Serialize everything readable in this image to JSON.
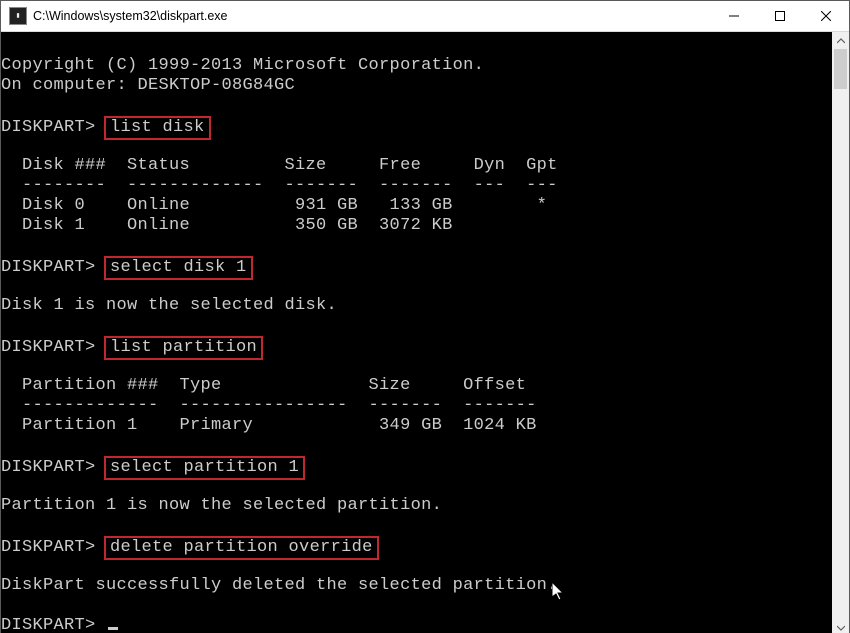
{
  "window": {
    "title": "C:\\Windows\\system32\\diskpart.exe",
    "icon_glyph": "C:\\"
  },
  "copyright": "Copyright (C) 1999-2013 Microsoft Corporation.",
  "computer_line": "On computer: DESKTOP-08G84GC",
  "prompt": "DISKPART>",
  "commands": {
    "c1": "list disk",
    "c2": "select disk 1",
    "c3": "list partition",
    "c4": "select partition 1",
    "c5": "delete partition override"
  },
  "disk_header": "  Disk ###  Status         Size     Free     Dyn  Gpt",
  "disk_divider": "  --------  -------------  -------  -------  ---  ---",
  "disks": {
    "d0": "  Disk 0    Online          931 GB   133 GB        *",
    "d1": "  Disk 1    Online          350 GB  3072 KB"
  },
  "msg_select_disk": "Disk 1 is now the selected disk.",
  "part_header": "  Partition ###  Type              Size     Offset",
  "part_divider": "  -------------  ----------------  -------  -------",
  "partitions": {
    "p1": "  Partition 1    Primary            349 GB  1024 KB"
  },
  "msg_select_part": "Partition 1 is now the selected partition.",
  "msg_deleted": "DiskPart successfully deleted the selected partition.",
  "highlight_color": "#c1272d"
}
